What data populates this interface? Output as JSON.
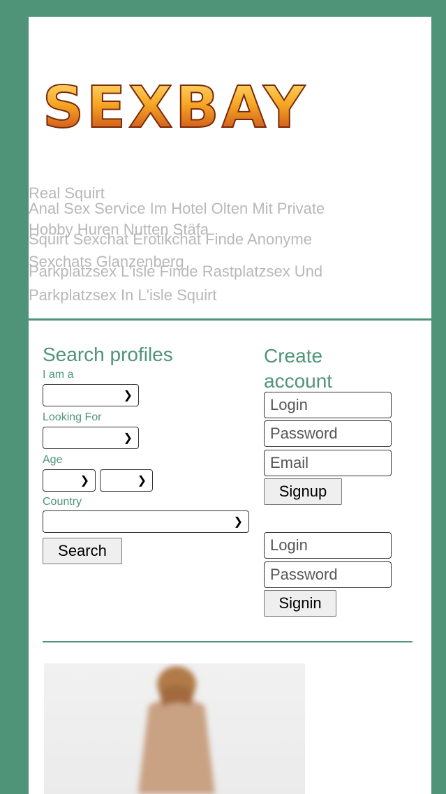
{
  "brand": {
    "logo_text": "SEXBAY",
    "accent": "#4f9478"
  },
  "overlay_text": {
    "line1": "Real Squirt",
    "line1b": "Anal Sex Service Im Hotel Olten Mit Private",
    "line2": "Hobby Huren Nutten Stäfa",
    "line2b": "Squirt Sexchat Erotikchat Finde Anonyme",
    "line3": "Sexchats Glanzenberg",
    "line3b": "Parkplatzsex L'isle Finde Rastplatzsex Und",
    "line4": "Parkplatzsex In L'isle Squirt"
  },
  "search": {
    "title": "Search profiles",
    "iam_label": "I am a",
    "looking_label": "Looking For",
    "age_label": "Age",
    "country_label": "Country",
    "button": "Search"
  },
  "create": {
    "title_line1": "Create",
    "title_line2": "account",
    "login_placeholder": "Login",
    "password_placeholder": "Password",
    "email_placeholder": "Email",
    "signup_button": "Signup"
  },
  "signin": {
    "login_placeholder": "Login",
    "password_placeholder": "Password",
    "signin_button": "Signin"
  }
}
